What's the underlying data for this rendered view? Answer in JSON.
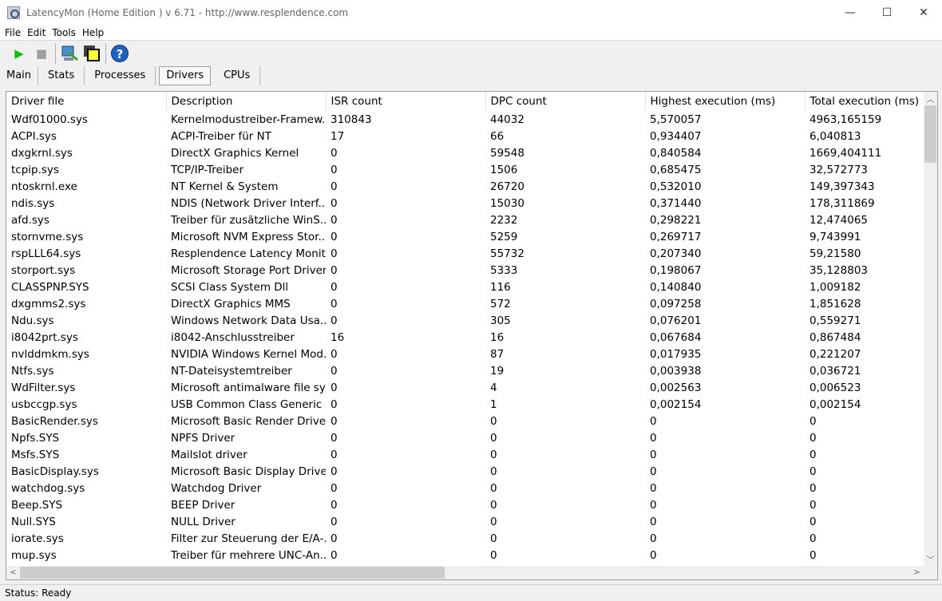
{
  "window": {
    "title": "LatencyMon  (Home Edition )  v 6.71 - http://www.resplendence.com",
    "minimize": "—",
    "maximize": "☐",
    "close": "✕"
  },
  "menu": [
    "File",
    "Edit",
    "Tools",
    "Help"
  ],
  "toolbar": {
    "play": "▶",
    "stop": "■",
    "help": "?"
  },
  "tabs": [
    "Main",
    "Stats",
    "Processes",
    "Drivers",
    "CPUs"
  ],
  "active_tab": "Drivers",
  "table": {
    "columns": [
      "Driver file",
      "Description",
      "ISR count",
      "DPC count",
      "Highest execution (ms)",
      "Total execution (ms)"
    ],
    "rows": [
      [
        "Wdf01000.sys",
        "Kernelmodustreiber-Framew...",
        "310843",
        "44032",
        "5,570057",
        "4963,165159"
      ],
      [
        "ACPI.sys",
        "ACPI-Treiber für NT",
        "17",
        "66",
        "0,934407",
        "6,040813"
      ],
      [
        "dxgkrnl.sys",
        "DirectX Graphics Kernel",
        "0",
        "59548",
        "0,840584",
        "1669,404111"
      ],
      [
        "tcpip.sys",
        "TCP/IP-Treiber",
        "0",
        "1506",
        "0,685475",
        "32,572773"
      ],
      [
        "ntoskrnl.exe",
        "NT Kernel & System",
        "0",
        "26720",
        "0,532010",
        "149,397343"
      ],
      [
        "ndis.sys",
        "NDIS (Network Driver Interf...",
        "0",
        "15030",
        "0,371440",
        "178,311869"
      ],
      [
        "afd.sys",
        "Treiber für zusätzliche WinS...",
        "0",
        "2232",
        "0,298221",
        "12,474065"
      ],
      [
        "stornvme.sys",
        "Microsoft NVM Express Stor...",
        "0",
        "5259",
        "0,269717",
        "9,743991"
      ],
      [
        "rspLLL64.sys",
        "Resplendence Latency Monit...",
        "0",
        "55732",
        "0,207340",
        "59,21580"
      ],
      [
        "storport.sys",
        "Microsoft Storage Port Driver",
        "0",
        "5333",
        "0,198067",
        "35,128803"
      ],
      [
        "CLASSPNP.SYS",
        "SCSI Class System Dll",
        "0",
        "116",
        "0,140840",
        "1,009182"
      ],
      [
        "dxgmms2.sys",
        "DirectX Graphics MMS",
        "0",
        "572",
        "0,097258",
        "1,851628"
      ],
      [
        "Ndu.sys",
        "Windows Network Data Usa...",
        "0",
        "305",
        "0,076201",
        "0,559271"
      ],
      [
        "i8042prt.sys",
        "i8042-Anschlusstreiber",
        "16",
        "16",
        "0,067684",
        "0,867484"
      ],
      [
        "nvlddmkm.sys",
        "NVIDIA Windows Kernel Mod...",
        "0",
        "87",
        "0,017935",
        "0,221207"
      ],
      [
        "Ntfs.sys",
        "NT-Dateisystemtreiber",
        "0",
        "19",
        "0,003938",
        "0,036721"
      ],
      [
        "WdFilter.sys",
        "Microsoft antimalware file sys...",
        "0",
        "4",
        "0,002563",
        "0,006523"
      ],
      [
        "usbccgp.sys",
        "USB Common Class Generic ...",
        "0",
        "1",
        "0,002154",
        "0,002154"
      ],
      [
        "BasicRender.sys",
        "Microsoft Basic Render Driver",
        "0",
        "0",
        "0",
        "0"
      ],
      [
        "Npfs.SYS",
        "NPFS Driver",
        "0",
        "0",
        "0",
        "0"
      ],
      [
        "Msfs.SYS",
        "Mailslot driver",
        "0",
        "0",
        "0",
        "0"
      ],
      [
        "BasicDisplay.sys",
        "Microsoft Basic Display Driver",
        "0",
        "0",
        "0",
        "0"
      ],
      [
        "watchdog.sys",
        "Watchdog Driver",
        "0",
        "0",
        "0",
        "0"
      ],
      [
        "Beep.SYS",
        "BEEP Driver",
        "0",
        "0",
        "0",
        "0"
      ],
      [
        "Null.SYS",
        "NULL Driver",
        "0",
        "0",
        "0",
        "0"
      ],
      [
        "iorate.sys",
        "Filter zur Steuerung der E/A-...",
        "0",
        "0",
        "0",
        "0"
      ],
      [
        "mup.sys",
        "Treiber für mehrere UNC-An...",
        "0",
        "0",
        "0",
        "0"
      ]
    ]
  },
  "status": "Status: Ready"
}
